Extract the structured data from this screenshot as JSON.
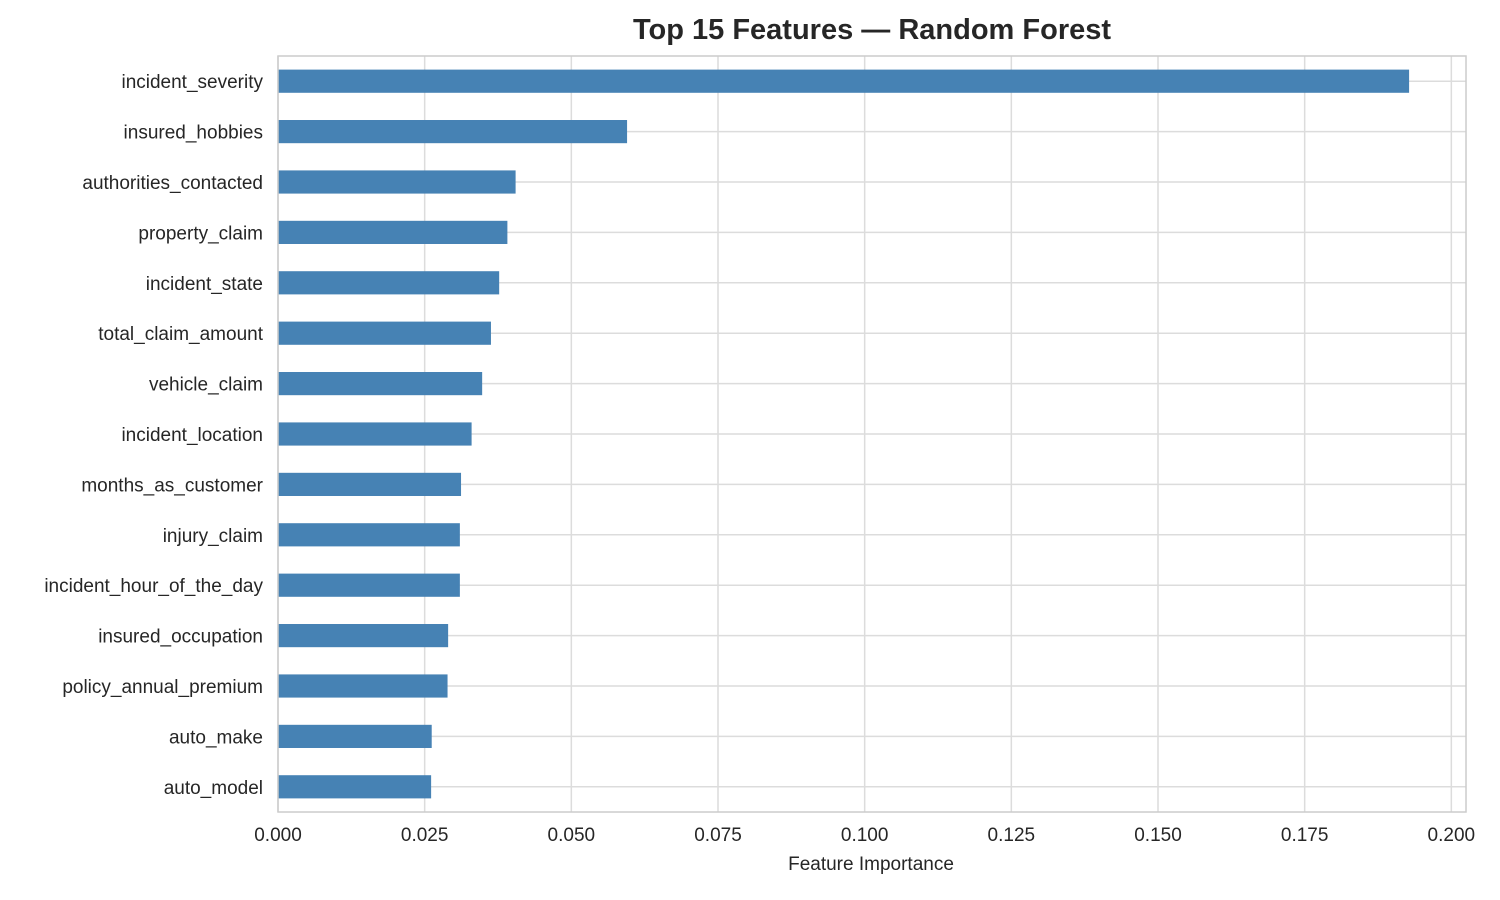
{
  "chart_data": {
    "type": "bar",
    "orientation": "horizontal",
    "title": "Top 15 Features — Random Forest",
    "xlabel": "Feature Importance",
    "ylabel": "",
    "xlim": [
      0,
      0.2025
    ],
    "xticks": [
      0.0,
      0.025,
      0.05,
      0.075,
      0.1,
      0.125,
      0.15,
      0.175,
      0.2
    ],
    "xtick_labels": [
      "0.000",
      "0.025",
      "0.050",
      "0.075",
      "0.100",
      "0.125",
      "0.150",
      "0.175",
      "0.200"
    ],
    "grid": true,
    "bar_color": "#4682b4",
    "categories": [
      "incident_severity",
      "insured_hobbies",
      "authorities_contacted",
      "property_claim",
      "incident_state",
      "total_claim_amount",
      "vehicle_claim",
      "incident_location",
      "months_as_customer",
      "injury_claim",
      "incident_hour_of_the_day",
      "insured_occupation",
      "policy_annual_premium",
      "auto_make",
      "auto_model"
    ],
    "values": [
      0.1928,
      0.0595,
      0.0405,
      0.0391,
      0.0377,
      0.0363,
      0.0348,
      0.033,
      0.0312,
      0.031,
      0.031,
      0.029,
      0.0289,
      0.0262,
      0.0261
    ]
  }
}
